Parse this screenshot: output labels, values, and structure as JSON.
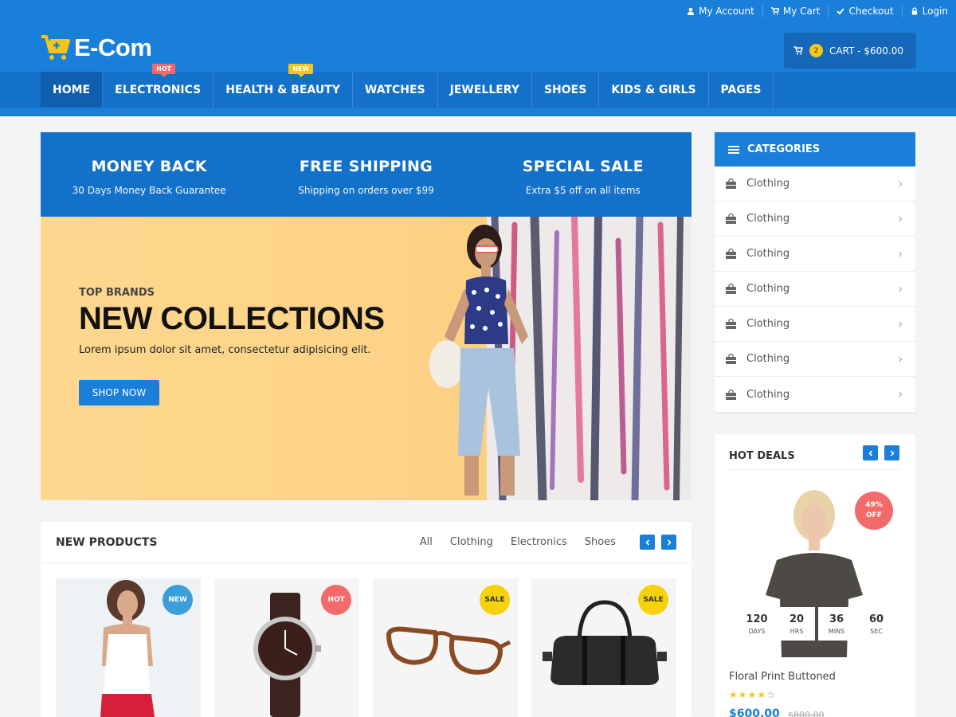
{
  "brand": {
    "name": "E-Com",
    "accent": "#1a7fd9",
    "accent_dark": "#1471c9",
    "hot": "#f36a6a",
    "yellow": "#f5c518"
  },
  "top_links": [
    {
      "label": "My Account",
      "icon": "user-icon"
    },
    {
      "label": "My Cart",
      "icon": "cart-icon"
    },
    {
      "label": "Checkout",
      "icon": "check-icon"
    },
    {
      "label": "Login",
      "icon": "lock-icon"
    }
  ],
  "cart": {
    "count": "2",
    "label": "CART - $600.00"
  },
  "nav": [
    {
      "label": "HOME",
      "active": true
    },
    {
      "label": "ELECTRONICS",
      "badge": "HOT"
    },
    {
      "label": "HEALTH & BEAUTY",
      "badge": "NEW"
    },
    {
      "label": "WATCHES"
    },
    {
      "label": "JEWELLERY"
    },
    {
      "label": "SHOES"
    },
    {
      "label": "KIDS & GIRLS"
    },
    {
      "label": "PAGES"
    }
  ],
  "features": [
    {
      "title": "MONEY BACK",
      "sub": "30 Days Money Back Guarantee"
    },
    {
      "title": "FREE SHIPPING",
      "sub": "Shipping on orders over $99"
    },
    {
      "title": "SPECIAL SALE",
      "sub": "Extra $5 off on all items"
    }
  ],
  "hero": {
    "kicker": "TOP BRANDS",
    "title": "NEW COLLECTIONS",
    "text": "Lorem ipsum dolor sit amet, consectetur adipisicing elit.",
    "button": "SHOP NOW"
  },
  "new_products": {
    "title": "NEW PRODUCTS",
    "tabs": [
      "All",
      "Clothing",
      "Electronics",
      "Shoes"
    ],
    "items": [
      {
        "badge": "NEW",
        "image": "woman-white-top"
      },
      {
        "badge": "HOT",
        "image": "wrist-watch"
      },
      {
        "badge": "SALE",
        "image": "eyeglasses"
      },
      {
        "badge": "SALE",
        "image": "black-duffel-bag"
      }
    ]
  },
  "categories": {
    "title": "CATEGORIES",
    "items": [
      "Clothing",
      "Clothing",
      "Clothing",
      "Clothing",
      "Clothing",
      "Clothing",
      "Clothing"
    ]
  },
  "hot_deals": {
    "title": "HOT DEALS",
    "discount_pct": "49%",
    "discount_label": "OFF",
    "countdown": [
      {
        "value": "120",
        "unit": "DAYS"
      },
      {
        "value": "20",
        "unit": "HRS"
      },
      {
        "value": "36",
        "unit": "MINS"
      },
      {
        "value": "60",
        "unit": "SEC"
      }
    ],
    "product_name": "Floral Print Buttoned",
    "rating": 4,
    "rating_max": 5,
    "price": "$600.00",
    "old_price": "$800.00"
  }
}
